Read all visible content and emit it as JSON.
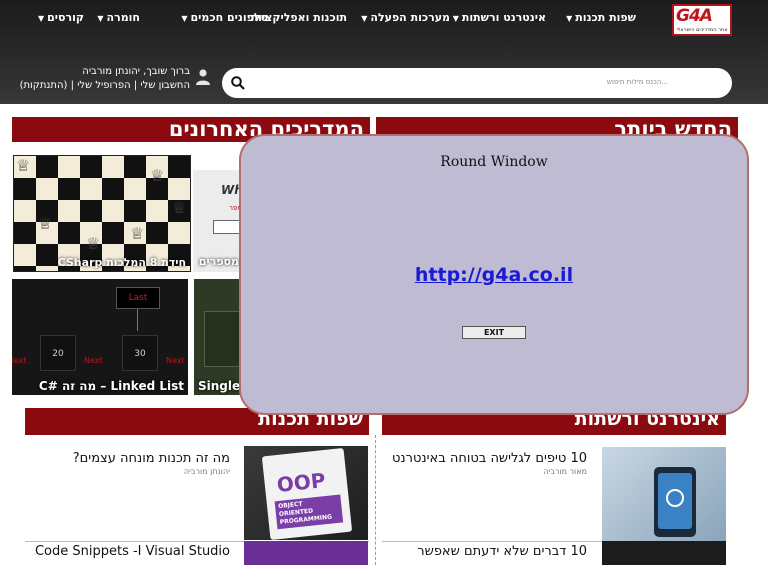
{
  "logo": {
    "mark": "G4A",
    "tagline": "אתר המדריכים הישראלי"
  },
  "nav": {
    "items": [
      {
        "label": "שפות תכנות",
        "caret": true
      },
      {
        "label": "אינטרנט ורשתות",
        "caret": true
      },
      {
        "label": "מערכות הפעלה",
        "caret": false
      },
      {
        "label": "תוכנות ואפליקציות",
        "caret": true
      },
      {
        "label": "טלפונים חכמים",
        "caret": false
      },
      {
        "label": "חומרה",
        "caret": true
      },
      {
        "label": "קורסים",
        "caret": false
      }
    ]
  },
  "search": {
    "placeholder": "הכנס מילות חיפוש..."
  },
  "user": {
    "greeting": "ברוך שובך, יהונתן מורביה",
    "links": [
      "החשבון שלי",
      "הפרופיל שלי",
      "(התנתקות)"
    ]
  },
  "sections": {
    "recent_guides": "המדריכים האחרונים",
    "newest": "החדש ביותר",
    "programming": "שפות תכנות",
    "internet": "אינטרנט ורשתות"
  },
  "tiles": {
    "chess_caption": "חידת 8 המלכות CSharp",
    "phone_caption": "מספרים",
    "phone_word": "What",
    "phone_sub": "מספר",
    "linked_caption": "Linked List – מה זה #C",
    "linked_last": "Last",
    "linked_nodes": [
      "20",
      "30"
    ],
    "linked_next": "Next",
    "single_caption": "Single"
  },
  "articles": {
    "left": [
      {
        "title": "מה זה תכנות מונחה עצמים?",
        "author": "יהונתן מורביה",
        "thumb_text": "OOP",
        "thumb_sub": "OBJECT ORIENTED PROGRAMMING"
      },
      {
        "title": "Code Snippets -I Visual Studio",
        "author": ""
      }
    ],
    "right": [
      {
        "title": "10 טיפים לגלישה בטוחה באינטרנט",
        "author": "מאור מורביה"
      },
      {
        "title": "10 דברים שלא ידעתם שאפשר",
        "author": ""
      }
    ]
  },
  "round_window": {
    "title": "Round Window",
    "link": "http://g4a.co.il",
    "exit_label": "EXIT"
  }
}
